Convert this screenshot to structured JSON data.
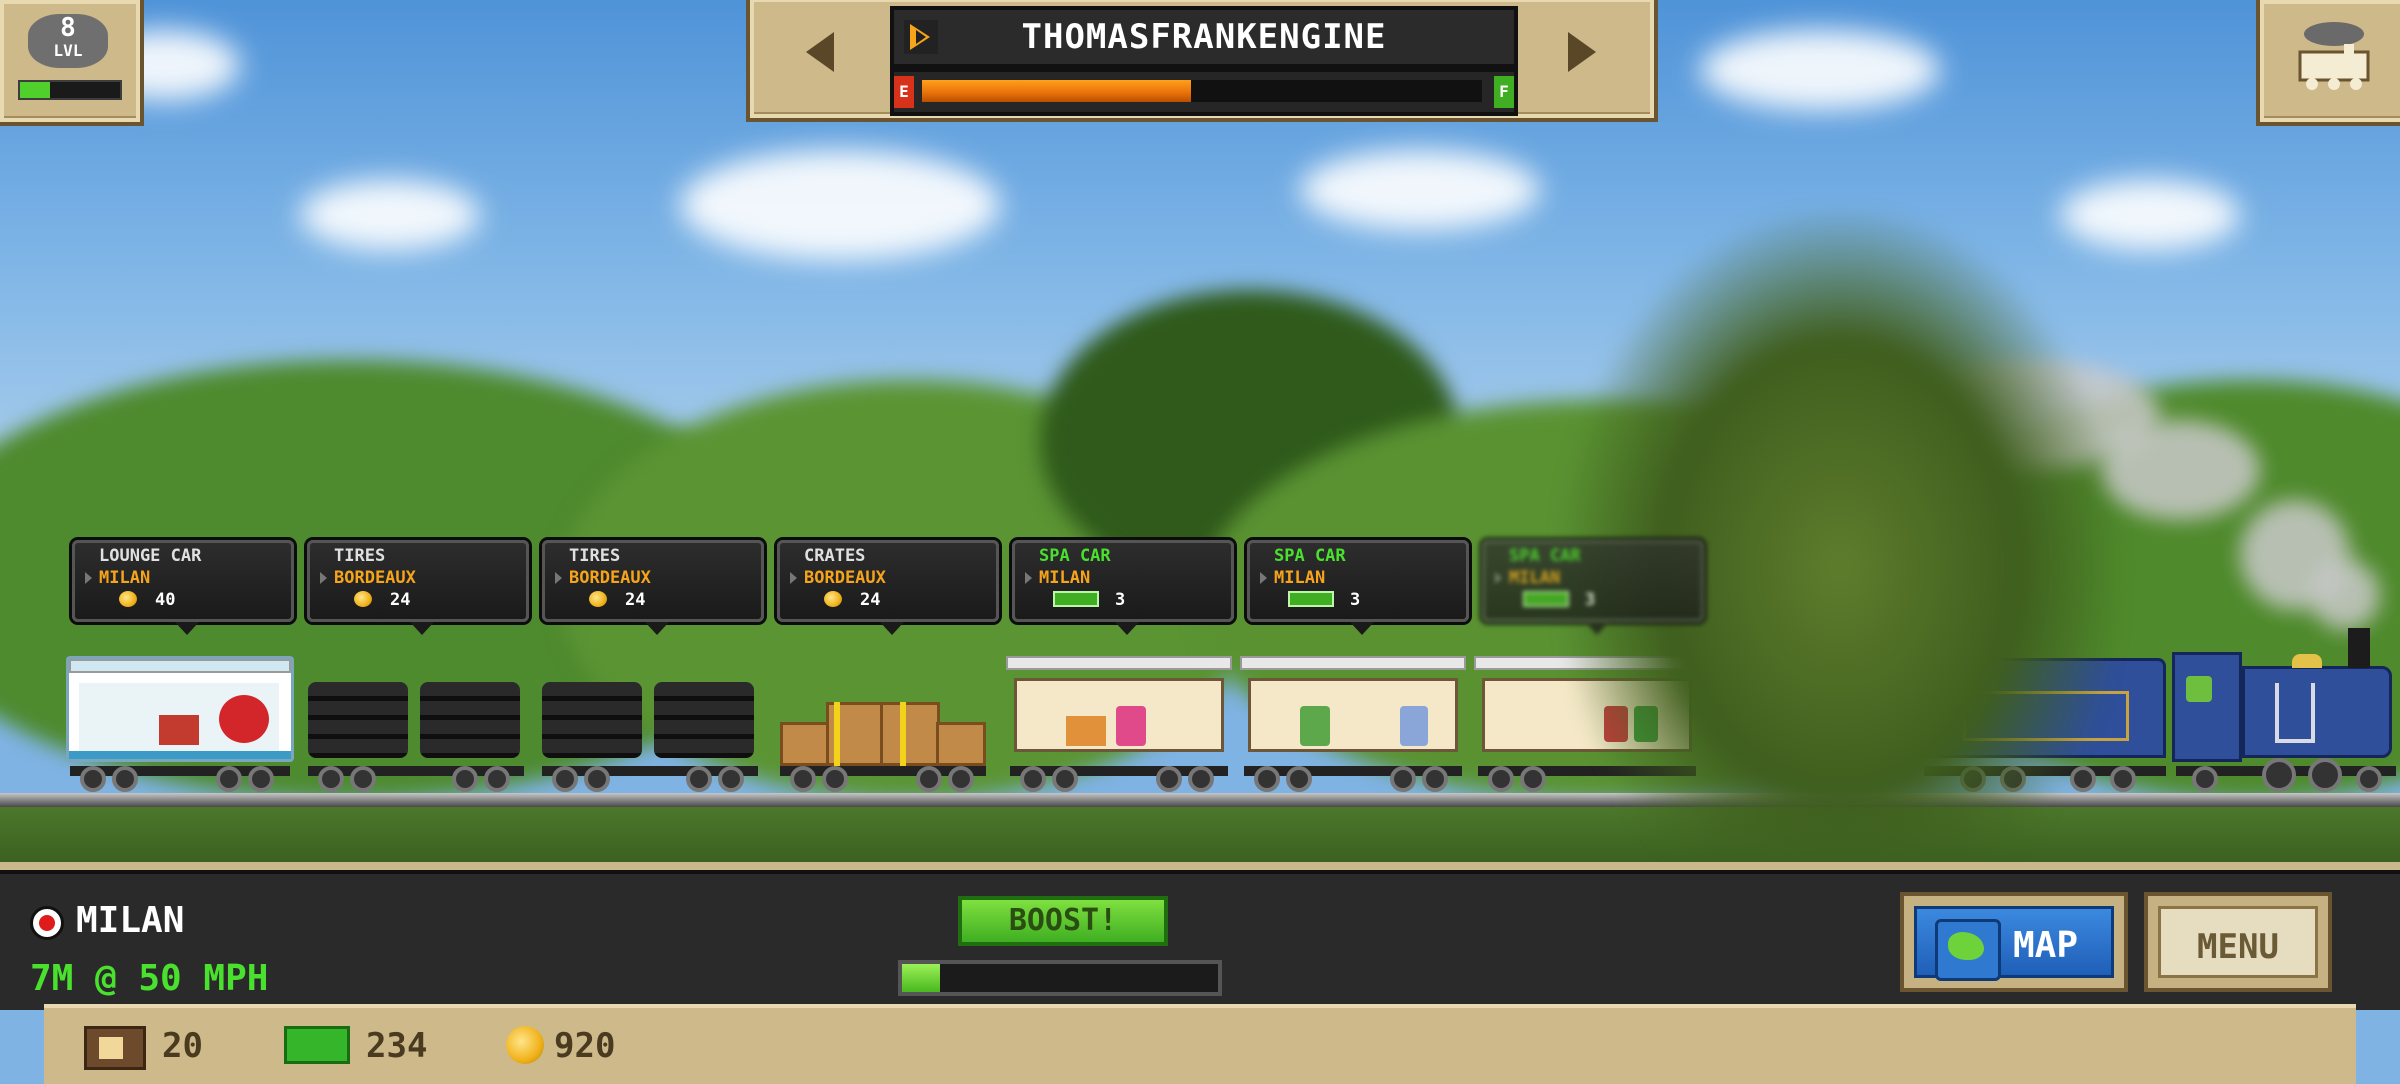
{
  "hud": {
    "level": {
      "value": "8",
      "label": "LVL",
      "xp_progress": 0.3
    },
    "train_name": "THOMASFRANKENGINE",
    "fuel": {
      "empty_label": "E",
      "full_label": "F",
      "level": 0.48
    }
  },
  "car_labels": [
    {
      "type": "LOUNGE CAR",
      "destination": "MILAN",
      "reward_icon": "coin-icon",
      "value": "40",
      "type_color": "#e0e0e0"
    },
    {
      "type": "TIRES",
      "destination": "BORDEAUX",
      "reward_icon": "coin-icon",
      "value": "24",
      "type_color": "#e0e0e0"
    },
    {
      "type": "TIRES",
      "destination": "BORDEAUX",
      "reward_icon": "coin-icon",
      "value": "24",
      "type_color": "#e0e0e0"
    },
    {
      "type": "CRATES",
      "destination": "BORDEAUX",
      "reward_icon": "coin-icon",
      "value": "24",
      "type_color": "#e0e0e0"
    },
    {
      "type": "SPA CAR",
      "destination": "MILAN",
      "reward_icon": "passenger-icon",
      "value": "3",
      "type_color": "#49e02e"
    },
    {
      "type": "SPA CAR",
      "destination": "MILAN",
      "reward_icon": "passenger-icon",
      "value": "3",
      "type_color": "#49e02e"
    },
    {
      "type": "SPA CAR",
      "destination": "MILAN",
      "reward_icon": "passenger-icon",
      "value": "3",
      "type_color": "#49e02e"
    }
  ],
  "status": {
    "station": "MILAN",
    "eta": "7M @ 50 MPH",
    "boost_label": "BOOST!",
    "boost_progress": 0.12
  },
  "buttons": {
    "map": "MAP",
    "menu": "MENU"
  },
  "currency": {
    "bux": "20",
    "cash": "234",
    "coins": "920"
  },
  "colors": {
    "accent_green": "#49e02e",
    "destination_orange": "#f5a41b",
    "fuel_orange": "#e8700a",
    "panel_tan": "#cdb98a"
  }
}
